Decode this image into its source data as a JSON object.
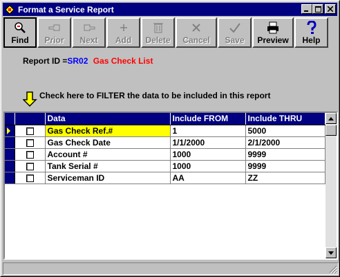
{
  "window": {
    "title": "Format a Service Report"
  },
  "toolbar": {
    "buttons": [
      {
        "label": "Find",
        "icon": "magnifier-icon",
        "enabled": true
      },
      {
        "label": "Prior",
        "icon": "left-hand-icon",
        "enabled": false
      },
      {
        "label": "Next",
        "icon": "right-hand-icon",
        "enabled": false
      },
      {
        "label": "Add",
        "icon": "plus-icon",
        "enabled": false
      },
      {
        "label": "Delete",
        "icon": "trash-icon",
        "enabled": false
      },
      {
        "label": "Cancel",
        "icon": "x-icon",
        "enabled": false
      },
      {
        "label": "Save",
        "icon": "checkmark-icon",
        "enabled": false
      },
      {
        "label": "Preview",
        "icon": "printer-icon",
        "enabled": true
      },
      {
        "label": "Help",
        "icon": "question-icon",
        "enabled": true
      }
    ]
  },
  "report": {
    "label": "Report ID",
    "equals": "=",
    "code": "SR02",
    "name": "Gas Check List"
  },
  "filter_hint": "Check here to FILTER the data to be included in this report",
  "grid": {
    "columns": [
      "Data",
      "Include FROM",
      "Include THRU"
    ],
    "rows": [
      {
        "data": "Gas Check Ref.#",
        "from": "1",
        "thru": "5000",
        "checked": false
      },
      {
        "data": "Gas Check Date",
        "from": "1/1/2000",
        "thru": "2/1/2000",
        "checked": false
      },
      {
        "data": "Account #",
        "from": "1000",
        "thru": "9999",
        "checked": false
      },
      {
        "data": "Tank Serial #",
        "from": "1000",
        "thru": "9999",
        "checked": false
      },
      {
        "data": "Serviceman ID",
        "from": "AA",
        "thru": "ZZ",
        "checked": false
      }
    ]
  },
  "colors": {
    "title_bar": "#000080",
    "report_code": "#0000ff",
    "report_name": "#ff0000",
    "current_row_highlight": "#ffff00",
    "grid_header": "#000080"
  }
}
